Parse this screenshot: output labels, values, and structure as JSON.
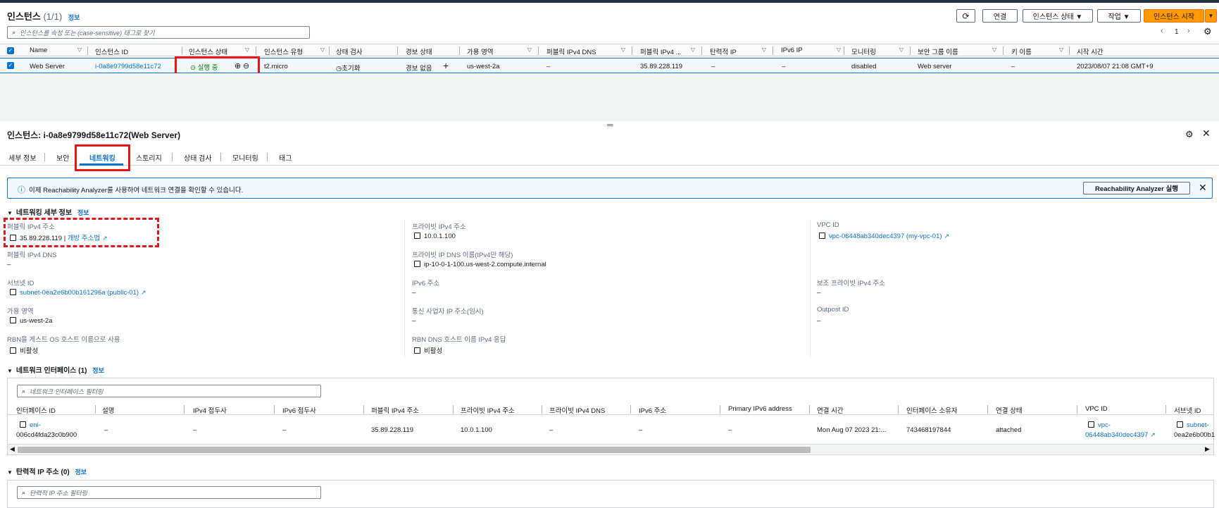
{
  "instances": {
    "title": "인스턴스",
    "count": "(1/1)",
    "info": "정보",
    "search_placeholder": "인스턴스를 속성 또는 (case-sensitive) 태그로 찾기",
    "buttons": {
      "connect": "연결",
      "state": "인스턴스 상태 ▼",
      "actions": "작업 ▼",
      "launch": "인스턴스 시작"
    },
    "pager": {
      "page": "1"
    },
    "columns": [
      "Name",
      "인스턴스 ID",
      "인스턴스 상태",
      "인스턴스 유형",
      "상태 검사",
      "경보 상태",
      "가용 영역",
      "퍼블릭 IPv4 DNS",
      "퍼블릭 IPv4 ...",
      "탄력적 IP",
      "IPv6 IP",
      "모니터링",
      "보안 그룹 이름",
      "키 이름",
      "시작 시간"
    ],
    "row": {
      "name": "Web Server",
      "id": "i-0a8e9799d58e11c72",
      "state": "실행 중",
      "type": "t2.micro",
      "check": "초기화",
      "alarm": "경보 없음",
      "az": "us-west-2a",
      "dns": "–",
      "ipv4": "35.89.228.119",
      "eip": "–",
      "ipv6": "–",
      "monitoring": "disabled",
      "sg": "Web server",
      "key": "–",
      "launch": "2023/08/07 21:08 GMT+9"
    }
  },
  "detail": {
    "title": "인스턴스: i-0a8e9799d58e11c72(Web Server)",
    "tabs": [
      "세부 정보",
      "보안",
      "네트워킹",
      "스토리지",
      "상태 검사",
      "모니터링",
      "태그"
    ],
    "active_tab": "네트워킹",
    "banner_text": "이제 Reachability Analyzer를 사용하여 네트워크 연결을 확인할 수 있습니다.",
    "banner_button": "Reachability Analyzer 실행",
    "net_details": {
      "heading": "네트워킹 세부 정보",
      "info": "정보",
      "public_ipv4_label": "퍼블릭 IPv4 주소",
      "public_ipv4": "35.89.228.119",
      "open_address": "개방 주소법",
      "public_dns_label": "퍼블릭 IPv4 DNS",
      "public_dns": "–",
      "subnet_label": "서브넷 ID",
      "subnet": "subnet-0ea2e6b00b161296a (public-01)",
      "az_label": "가용 영역",
      "az": "us-west-2a",
      "rbn_label": "RBN을 게스트 OS 호스트 이름으로 사용",
      "rbn": "비활성",
      "private_ipv4_label": "프라이빗 IPv4 주소",
      "private_ipv4": "10.0.1.100",
      "private_dns_label": "프라이빗 IP DNS 이름(IPv4만 해당)",
      "private_dns": "ip-10-0-1-100.us-west-2.compute.internal",
      "ipv6_label": "IPv6 주소",
      "ipv6": "–",
      "carrier_label": "통신 사업자 IP 주소(임시)",
      "carrier": "–",
      "rbn_dns_label": "RBN DNS 호스트 이름 IPv4 응답",
      "rbn_dns": "비활성",
      "vpc_label": "VPC ID",
      "vpc": "vpc-06448ab340dec4397 (my-vpc-01)",
      "secondary_label": "보조 프라이빗 IPv4 주소",
      "secondary": "–",
      "outpost_label": "Outpost ID",
      "outpost": "–"
    },
    "eni": {
      "heading": "네트워크 인터페이스 (1)",
      "info": "정보",
      "filter_placeholder": "네트워크 인터페이스 필터링",
      "columns": [
        "인터페이스 ID",
        "설명",
        "IPv4 접두사",
        "IPv6 접두사",
        "퍼블릭 IPv4 주소",
        "프라이빗 IPv4 주소",
        "프라이빗 IPv4 DNS",
        "IPv6 주소",
        "Primary IPv6 address",
        "연결 시간",
        "인터페이스 소유자",
        "연결 상태",
        "VPC ID",
        "서브넷 ID"
      ],
      "row": {
        "id_1": "eni-",
        "id_2": "006cd4fda23c0b900",
        "desc": "–",
        "ipv4_prefix": "–",
        "ipv6_prefix": "–",
        "public_ipv4": "35.89.228.119",
        "private_ipv4": "10.0.1.100",
        "private_dns": "–",
        "ipv6": "–",
        "primary_ipv6": "–",
        "attach_time": "Mon Aug 07 2023 21:...",
        "owner": "743468197844",
        "status": "attached",
        "vpc_1": "vpc-",
        "vpc_2": "06448ab340dec4397",
        "subnet_1": "subnet-",
        "subnet_2": "0ea2e6b00b1"
      }
    },
    "eip": {
      "heading": "탄력적 IP 주소 (0)",
      "info": "정보",
      "filter_placeholder": "탄력적 IP 주소 필터링"
    }
  }
}
